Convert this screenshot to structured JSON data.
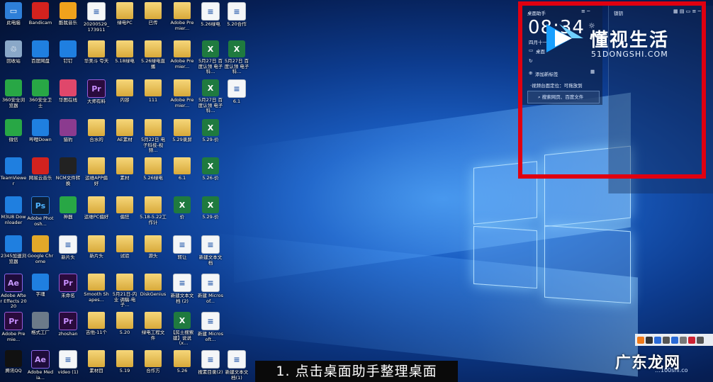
{
  "desktop_icons": [
    {
      "label": "此电脑",
      "kind": "pc",
      "col": 0,
      "row": 0
    },
    {
      "label": "Bandicam",
      "kind": "app-red",
      "col": 1,
      "row": 0
    },
    {
      "label": "酷我音乐",
      "kind": "app-orange",
      "col": 2,
      "row": 0
    },
    {
      "label": "20200529_173911",
      "kind": "doc",
      "col": 3,
      "row": 0
    },
    {
      "label": "绿电PC",
      "kind": "folder",
      "col": 4,
      "row": 0
    },
    {
      "label": "已传",
      "kind": "folder",
      "col": 5,
      "row": 0
    },
    {
      "label": "Adobe Premier...",
      "kind": "folder",
      "col": 6,
      "row": 0
    },
    {
      "label": "5.26绿电",
      "kind": "doc",
      "col": 7,
      "row": 0
    },
    {
      "label": "5.20合作",
      "kind": "doc",
      "col": 8,
      "row": 0
    },
    {
      "label": "回收站",
      "kind": "bin",
      "col": 0,
      "row": 1
    },
    {
      "label": "百度网盘",
      "kind": "app-blue",
      "col": 1,
      "row": 1
    },
    {
      "label": "钉钉",
      "kind": "app-blue",
      "col": 2,
      "row": 1
    },
    {
      "label": "华美斗 夸天",
      "kind": "folder",
      "col": 3,
      "row": 1
    },
    {
      "label": "5.18绿电",
      "kind": "folder",
      "col": 4,
      "row": 1
    },
    {
      "label": "5.26绿电直播",
      "kind": "folder",
      "col": 5,
      "row": 1
    },
    {
      "label": "Adobe Premier...",
      "kind": "folder",
      "col": 6,
      "row": 1
    },
    {
      "label": "5月27日 百度认领 电子科...",
      "kind": "xls",
      "col": 7,
      "row": 1
    },
    {
      "label": "5月27日 百度认领 电子科...",
      "kind": "xls",
      "col": 8,
      "row": 1
    },
    {
      "label": "360安全浏览器",
      "kind": "app-green",
      "col": 0,
      "row": 2
    },
    {
      "label": "360安全卫士",
      "kind": "app-green",
      "col": 1,
      "row": 2
    },
    {
      "label": "华图在线",
      "kind": "app-pink",
      "col": 2,
      "row": 2
    },
    {
      "label": "大师有料",
      "kind": "pr",
      "col": 3,
      "row": 2
    },
    {
      "label": "内容",
      "kind": "folder",
      "col": 4,
      "row": 2
    },
    {
      "label": "111",
      "kind": "folder",
      "col": 5,
      "row": 2
    },
    {
      "label": "Adobe Premier...",
      "kind": "folder",
      "col": 6,
      "row": 2
    },
    {
      "label": "5月27日 百度认领 电子科...",
      "kind": "xls",
      "col": 7,
      "row": 2
    },
    {
      "label": "6.1",
      "kind": "doc",
      "col": 8,
      "row": 2
    },
    {
      "label": "微信",
      "kind": "app-green",
      "col": 0,
      "row": 3
    },
    {
      "label": "哔哩Down",
      "kind": "app-blue",
      "col": 1,
      "row": 3
    },
    {
      "label": "猎豹",
      "kind": "app-rar",
      "col": 2,
      "row": 3
    },
    {
      "label": "合水的",
      "kind": "folder",
      "col": 3,
      "row": 3
    },
    {
      "label": "AE素材",
      "kind": "folder",
      "col": 4,
      "row": 3
    },
    {
      "label": "5月22日 电子科技-视频...",
      "kind": "folder",
      "col": 5,
      "row": 3
    },
    {
      "label": "5.29录屏",
      "kind": "folder",
      "col": 6,
      "row": 3
    },
    {
      "label": "5.29-价",
      "kind": "xls",
      "col": 7,
      "row": 3
    },
    {
      "label": "TeamViewer",
      "kind": "app-blue",
      "col": 0,
      "row": 4
    },
    {
      "label": "网易云音乐",
      "kind": "app-red",
      "col": 1,
      "row": 4
    },
    {
      "label": "NCM文件转换",
      "kind": "app-dark",
      "col": 2,
      "row": 4
    },
    {
      "label": "运维APP偏好",
      "kind": "folder",
      "col": 3,
      "row": 4
    },
    {
      "label": "素材",
      "kind": "folder",
      "col": 4,
      "row": 4
    },
    {
      "label": "5.26绿电",
      "kind": "folder",
      "col": 5,
      "row": 4
    },
    {
      "label": "6.1",
      "kind": "folder",
      "col": 6,
      "row": 4
    },
    {
      "label": "5.26-价",
      "kind": "xls",
      "col": 7,
      "row": 4
    },
    {
      "label": "M3U8 Downloader",
      "kind": "app-blue",
      "col": 0,
      "row": 5
    },
    {
      "label": "Adobe Photosh...",
      "kind": "ps",
      "col": 1,
      "row": 5
    },
    {
      "label": "神器",
      "kind": "app-green",
      "col": 2,
      "row": 5
    },
    {
      "label": "运维PC偏好",
      "kind": "folder",
      "col": 3,
      "row": 5
    },
    {
      "label": "偏狂",
      "kind": "folder",
      "col": 4,
      "row": 5
    },
    {
      "label": "5.18-5.22工作计",
      "kind": "folder",
      "col": 5,
      "row": 5
    },
    {
      "label": "价",
      "kind": "xls",
      "col": 6,
      "row": 5
    },
    {
      "label": "5.29-价",
      "kind": "xls",
      "col": 7,
      "row": 5
    },
    {
      "label": "2345加速浏览器",
      "kind": "app-blue",
      "col": 0,
      "row": 6
    },
    {
      "label": "Google Chrome",
      "kind": "app-chrome",
      "col": 1,
      "row": 6
    },
    {
      "label": "新片头",
      "kind": "doc",
      "col": 2,
      "row": 6
    },
    {
      "label": "新片头",
      "kind": "folder",
      "col": 3,
      "row": 6
    },
    {
      "label": "试验",
      "kind": "folder",
      "col": 4,
      "row": 6
    },
    {
      "label": "源头",
      "kind": "folder",
      "col": 5,
      "row": 6
    },
    {
      "label": "转让",
      "kind": "doc",
      "col": 6,
      "row": 6
    },
    {
      "label": "新建文本文档",
      "kind": "doc",
      "col": 7,
      "row": 6
    },
    {
      "label": "Adobe After Effects 2020",
      "kind": "ae",
      "col": 0,
      "row": 7
    },
    {
      "label": "字魂",
      "kind": "app-blue",
      "col": 1,
      "row": 7
    },
    {
      "label": "未命名",
      "kind": "pr",
      "col": 2,
      "row": 7
    },
    {
      "label": "Smooth Shapes...",
      "kind": "folder",
      "col": 3,
      "row": 7
    },
    {
      "label": "5月21日-内业 调稿-电子...",
      "kind": "folder",
      "col": 4,
      "row": 7
    },
    {
      "label": "DiskGenius",
      "kind": "folder",
      "col": 5,
      "row": 7
    },
    {
      "label": "新建文本文档 (2)",
      "kind": "doc",
      "col": 6,
      "row": 7
    },
    {
      "label": "新建 Microsof...",
      "kind": "doc",
      "col": 7,
      "row": 7
    },
    {
      "label": "Adobe Premie...",
      "kind": "pr",
      "col": 0,
      "row": 8
    },
    {
      "label": "格式工厂",
      "kind": "app-gray",
      "col": 1,
      "row": 8
    },
    {
      "label": "zhoshan",
      "kind": "pr",
      "col": 2,
      "row": 8
    },
    {
      "label": "吉他-11个",
      "kind": "folder",
      "col": 3,
      "row": 8
    },
    {
      "label": "5.20",
      "kind": "folder",
      "col": 4,
      "row": 8
    },
    {
      "label": "绿电工程文件",
      "kind": "folder",
      "col": 5,
      "row": 8
    },
    {
      "label": "【房土搜索建】说说（x...",
      "kind": "xls",
      "col": 6,
      "row": 8
    },
    {
      "label": "新建 Microsoft...",
      "kind": "doc",
      "col": 7,
      "row": 8
    },
    {
      "label": "腾讯QQ",
      "kind": "app-qq",
      "col": 0,
      "row": 9
    },
    {
      "label": "Adobe Media...",
      "kind": "ae",
      "col": 1,
      "row": 9
    },
    {
      "label": "video (1)",
      "kind": "doc",
      "col": 2,
      "row": 9
    },
    {
      "label": "素材目",
      "kind": "folder",
      "col": 3,
      "row": 9
    },
    {
      "label": "5.19",
      "kind": "folder",
      "col": 4,
      "row": 9
    },
    {
      "label": "合作方",
      "kind": "folder",
      "col": 5,
      "row": 9
    },
    {
      "label": "5.26",
      "kind": "folder",
      "col": 6,
      "row": 9
    },
    {
      "label": "搜素目录(2)",
      "kind": "doc",
      "col": 7,
      "row": 9
    },
    {
      "label": "新建文本文档(1)",
      "kind": "doc",
      "col": 8,
      "row": 9
    }
  ],
  "widget": {
    "title": "桌面助手",
    "panel2_title": "锁钥",
    "time": "08:34",
    "date_line": "四月十一  08",
    "item1": "桌面",
    "add_label": "添加新标签",
    "tip": "·视频台面定位：可拖放到",
    "search": "搜索网页、百度文件"
  },
  "brand": {
    "cn": "懂视生活",
    "en": "51DONGSHI.COM"
  },
  "caption": "1. 点击桌面助手整理桌面",
  "watermark": {
    "cn": "广东龙网",
    "en": "…100shi.co"
  }
}
